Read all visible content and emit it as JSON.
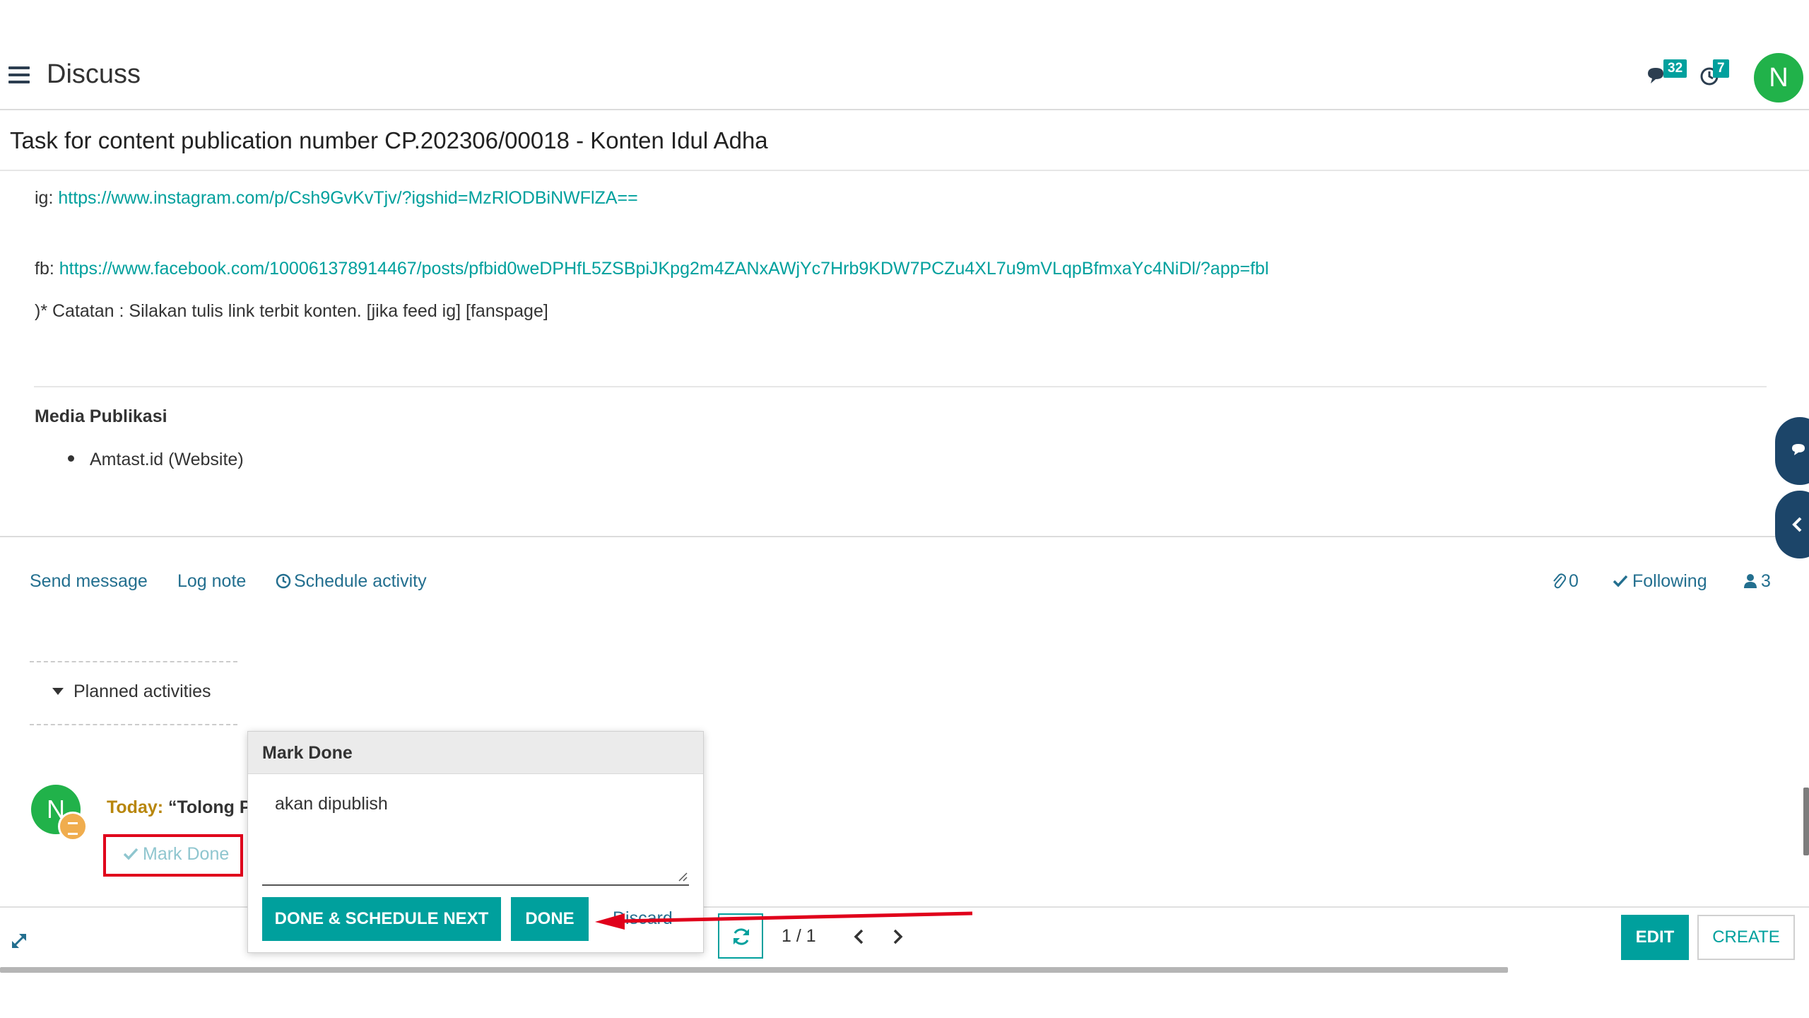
{
  "app": {
    "title": "Discuss",
    "messages_badge": "32",
    "activities_badge": "7",
    "user_initial": "N"
  },
  "record": {
    "title": "Task for content publication number CP.202306/00018 - Konten Idul Adha"
  },
  "content": {
    "ig_label": "ig:",
    "ig_url": "https://www.instagram.com/p/Csh9GvKvTjv/?igshid=MzRlODBiNWFlZA==",
    "fb_label": "fb:",
    "fb_url": "https://www.facebook.com/100061378914467/posts/pfbid0weDPHfL5ZSBpiJKpg2m4ZANxAWjYc7Hrb9KDW7PCZu4XL7u9mVLqpBfmxaYc4NiDl/?app=fbl",
    "note": ")* Catatan : Silakan tulis link terbit konten. [jika feed ig] [fanspage]",
    "media_heading": "Media Publikasi",
    "media_items": [
      "Amtast.id (Website)"
    ]
  },
  "chatter": {
    "send_message": "Send message",
    "log_note": "Log note",
    "schedule_activity": "Schedule activity",
    "attachments_count": "0",
    "following": "Following",
    "followers_count": "3",
    "planned_activities": "Planned activities"
  },
  "activity": {
    "avatar_initial": "N",
    "when": "Today:",
    "summary": "“Tolong P",
    "mark_done": "Mark Done"
  },
  "popover": {
    "title": "Mark Done",
    "feedback_value": "akan dipublish",
    "done_schedule_next": "DONE & SCHEDULE NEXT",
    "done": "DONE",
    "discard": "Discard"
  },
  "pager": {
    "value": "1 / 1"
  },
  "buttons": {
    "edit": "EDIT",
    "create": "CREATE"
  },
  "colors": {
    "accent": "#00a09d",
    "link": "#236f8f",
    "avatar": "#21b24a",
    "annotation_red": "#e0001b",
    "side_tab": "#1c4569"
  }
}
